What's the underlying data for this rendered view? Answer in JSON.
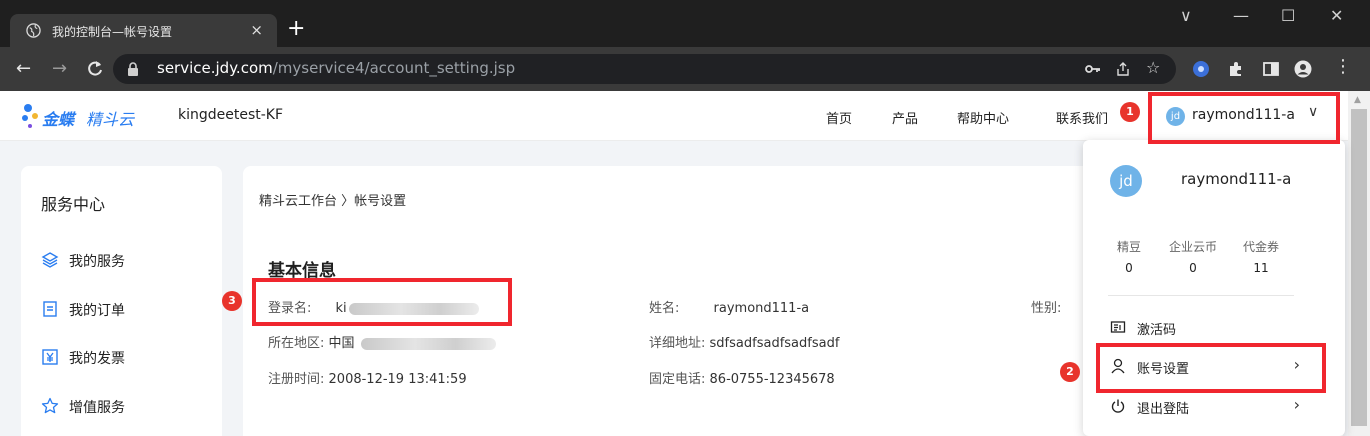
{
  "browser": {
    "tab_title": "我的控制台—帐号设置",
    "tab_close": "×",
    "new_tab": "+",
    "url_host": "service.jdy.com",
    "url_path": "/myservice4/account_setting.jsp",
    "window_controls": [
      "∨",
      "—",
      "☐",
      "✕"
    ]
  },
  "header": {
    "logo_brand": "金蝶",
    "logo_product": "精斗云",
    "tenant": "kingdeetest-KF",
    "nav": [
      "首页",
      "产品",
      "帮助中心",
      "联系我们"
    ],
    "user_avatar": "jd",
    "user_name": "raymond111-a"
  },
  "sidebar": {
    "heading": "服务中心",
    "items": [
      {
        "label": "我的服务",
        "icon": "layers-icon"
      },
      {
        "label": "我的订单",
        "icon": "document-icon"
      },
      {
        "label": "我的发票",
        "icon": "yen-invoice-icon"
      },
      {
        "label": "增值服务",
        "icon": "star-icon"
      }
    ]
  },
  "main": {
    "breadcrumb": "精斗云工作台 〉帐号设置",
    "section_title": "基本信息",
    "fields": {
      "login_label": "登录名:",
      "login_value_visible": "ki",
      "region_label": "所在地区:",
      "region_value_visible": "中国",
      "register_label": "注册时间:",
      "register_value": "2008-12-19 13:41:59",
      "name_label": "姓名:",
      "name_value": "raymond111-a",
      "address_label": "详细地址:",
      "address_value": "sdfsadfsadfsadfsadf",
      "phone_label": "固定电话:",
      "phone_value": "86-0755-12345678",
      "gender_label": "性别:"
    }
  },
  "dropdown": {
    "avatar": "jd",
    "name": "raymond111-a",
    "stats": [
      {
        "label": "精豆",
        "value": "0"
      },
      {
        "label": "企业云币",
        "value": "0"
      },
      {
        "label": "代金券",
        "value": "11"
      }
    ],
    "menu": [
      {
        "label": "激活码",
        "icon": "activation-code-icon",
        "arrow": ""
      },
      {
        "label": "账号设置",
        "icon": "user-icon",
        "arrow": "›"
      },
      {
        "label": "退出登陆",
        "icon": "power-icon",
        "arrow": "›"
      }
    ]
  },
  "annotations": [
    "1",
    "2",
    "3"
  ],
  "colors": {
    "highlight": "#f0262e",
    "marker": "#e8342c",
    "brand": "#2a7df0",
    "avatar": "#6fb3e8"
  }
}
